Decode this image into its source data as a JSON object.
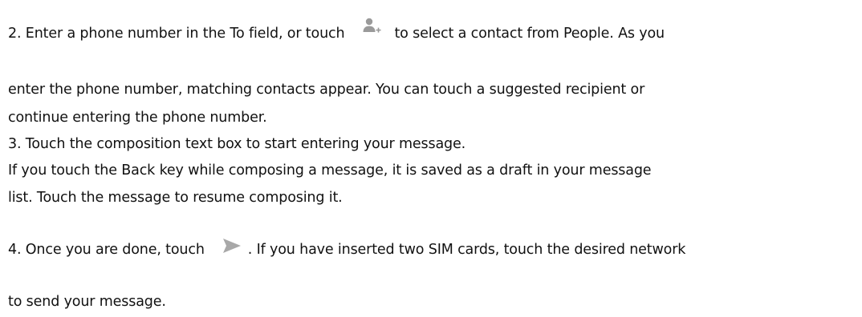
{
  "document": {
    "step2": {
      "before_icon": "2. Enter a phone number in the To field, or touch",
      "icon": "add-contact-icon",
      "after_icon": "to select a contact from People. As you",
      "line2": "enter the phone number, matching contacts appear. You can touch a suggested recipient or",
      "line3": "continue entering the phone number."
    },
    "step3": {
      "text": "3. Touch the composition text box to start entering your message."
    },
    "note": {
      "line1": "If you touch the Back key while composing a message, it is saved as a draft in your message",
      "line2": "list. Touch the message to resume composing it."
    },
    "step4": {
      "before_icon": "4. Once you are done, touch",
      "icon": "send-icon",
      "after_icon": ". If you have inserted two SIM cards, touch the desired network",
      "line2": "to send your message."
    }
  },
  "colors": {
    "text": "#111111",
    "icon_gray": "#9a9a9a"
  }
}
